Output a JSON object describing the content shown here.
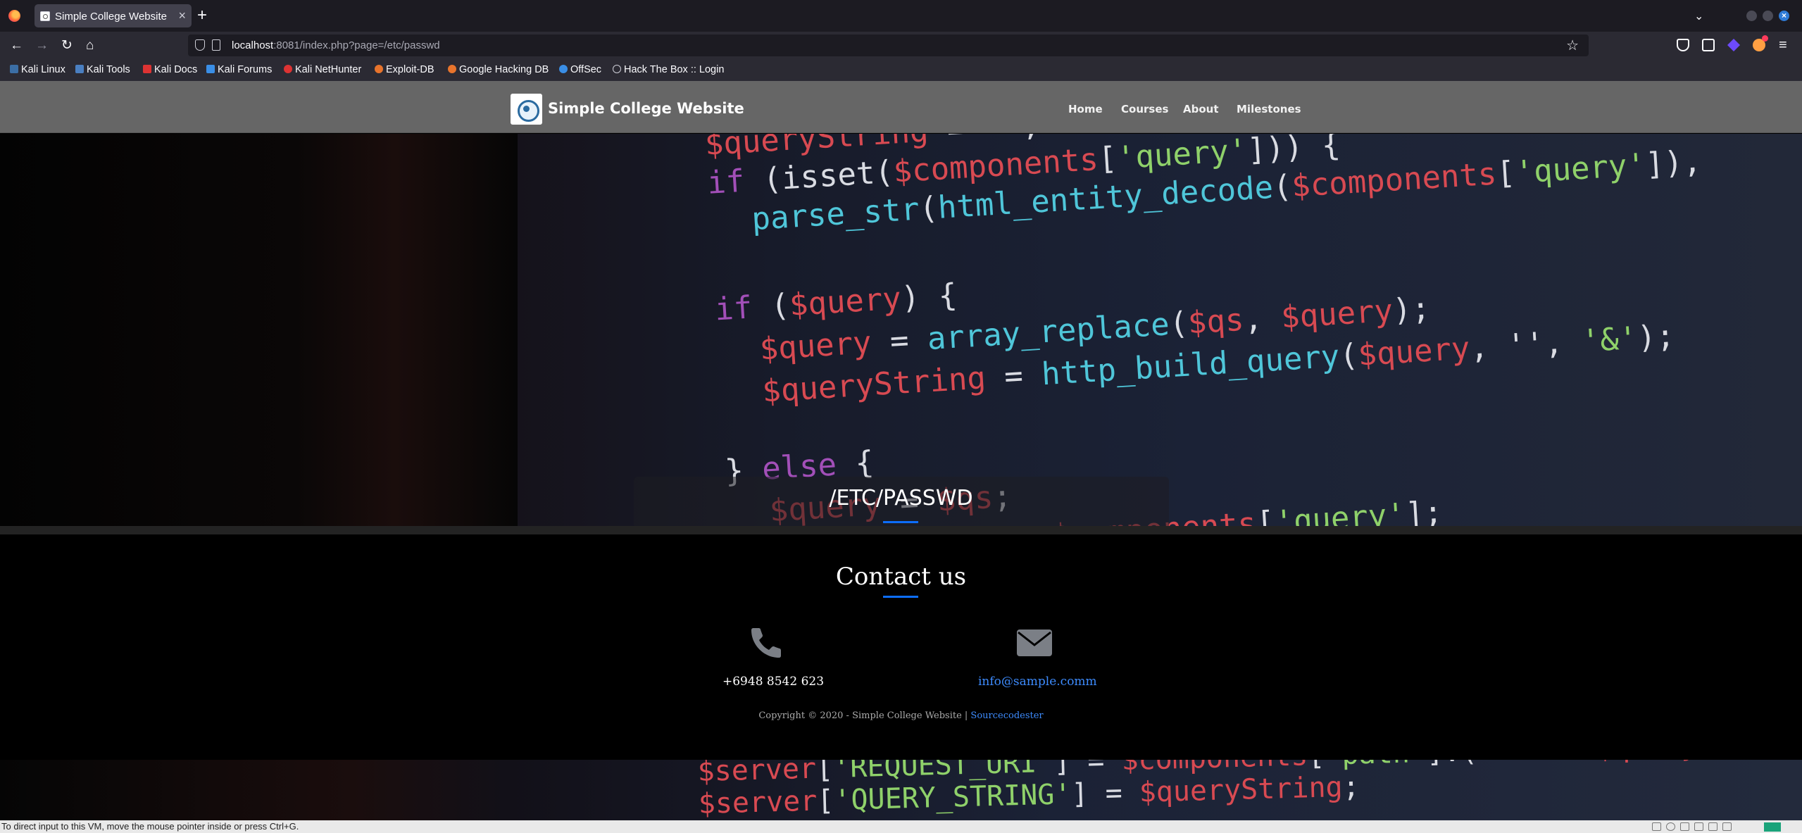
{
  "browser": {
    "tab_title": "Simple College Website",
    "tab_close": "×",
    "new_tab": "+",
    "tab_list": "⌄",
    "window_close": "×",
    "url_host": "localhost",
    "url_rest": ":8081/index.php?page=/etc/passwd",
    "bookmarks": [
      {
        "label": "Kali Linux",
        "color": "#3b6ea5"
      },
      {
        "label": "Kali Tools",
        "color": "#4a7fc1"
      },
      {
        "label": "Kali Docs",
        "color": "#d33"
      },
      {
        "label": "Kali Forums",
        "color": "#3a8ee6"
      },
      {
        "label": "Kali NetHunter",
        "color": "#d33"
      },
      {
        "label": "Exploit-DB",
        "color": "#e8742c"
      },
      {
        "label": "Google Hacking DB",
        "color": "#e8742c"
      },
      {
        "label": "OffSec",
        "color": "#3a8ee6"
      },
      {
        "label": "Hack The Box :: Login",
        "color": "#cfcfd8"
      }
    ]
  },
  "site": {
    "brand": "Simple College Website",
    "menu": [
      "Home",
      "Courses",
      "About",
      "Milestones"
    ],
    "hero_title": "/ETC/PASSWD",
    "contact": {
      "title": "Contact us",
      "phone": "+6948 8542 623",
      "email": "info@sample.comm",
      "copyright_prefix": "Copyright © 2020 - Simple College Website | ",
      "copyright_link": "Sourcecodester"
    }
  },
  "vm_status": "To direct input to this VM, move the mouse pointer inside or press Ctrl+G.",
  "colors": {
    "accent": "#0d6efd",
    "link": "#3d8bfd",
    "navbar": "#666666"
  }
}
